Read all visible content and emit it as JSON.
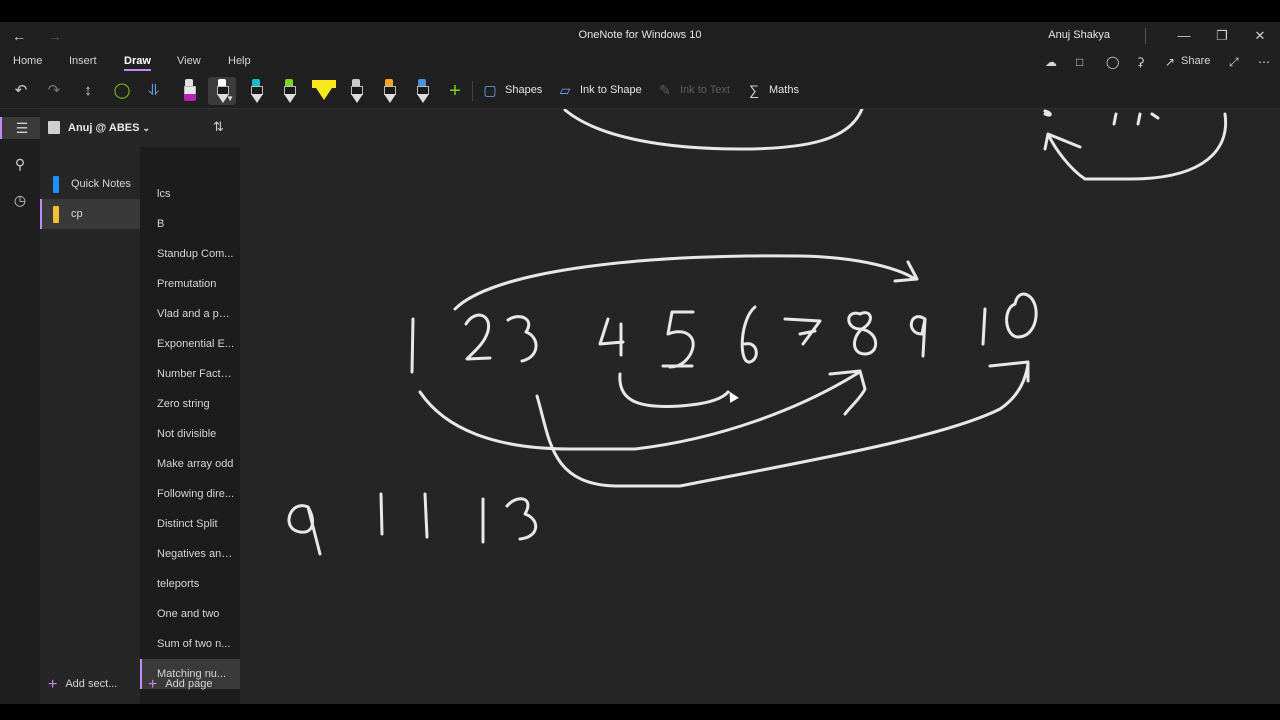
{
  "window": {
    "title": "OneNote for Windows 10",
    "user": "Anuj Shakya"
  },
  "ribbon": {
    "tabs": [
      "Home",
      "Insert",
      "Draw",
      "View",
      "Help"
    ],
    "active_tab": "Draw",
    "share_label": "Share"
  },
  "toolbar": {
    "shapes_label": "Shapes",
    "ink_to_shape_label": "Ink to Shape",
    "ink_to_text_label": "Ink to Text",
    "maths_label": "Maths",
    "pen_colors": [
      "#ffffff",
      "#1fb6d1",
      "#7ed321",
      "#f8e71c",
      "#cccccc",
      "#f5a623",
      "#4a90e2"
    ],
    "highlighter_color": "#b621b6"
  },
  "notebook": {
    "name": "Anuj @ ABES",
    "sections": [
      {
        "label": "Quick Notes",
        "color": "#1e90ff"
      },
      {
        "label": "cp",
        "color": "#f1c232"
      }
    ],
    "active_section": "cp"
  },
  "pages": {
    "items": [
      "lcs",
      "B",
      "Standup Com...",
      "Premutation",
      "Vlad and a pai...",
      "Exponential E...",
      "Number Facto...",
      "Zero string",
      "Not divisible",
      "Make array odd",
      "Following dire...",
      "Distinct Split",
      "Negatives and...",
      "teleports",
      "One and two",
      "Sum of two n...",
      "Matching nu..."
    ],
    "active": "Matching nu..."
  },
  "footer": {
    "add_section": "Add sect...",
    "add_page": "Add page"
  },
  "ink": {
    "row1": [
      "1",
      "2",
      "3",
      "4",
      "5",
      "6",
      "7",
      "8",
      "9",
      "10"
    ],
    "row2": [
      "9",
      "11",
      "13"
    ]
  },
  "colors": {
    "accent": "#c58af9",
    "background": "#252525",
    "ink": "#e8e8e8"
  }
}
